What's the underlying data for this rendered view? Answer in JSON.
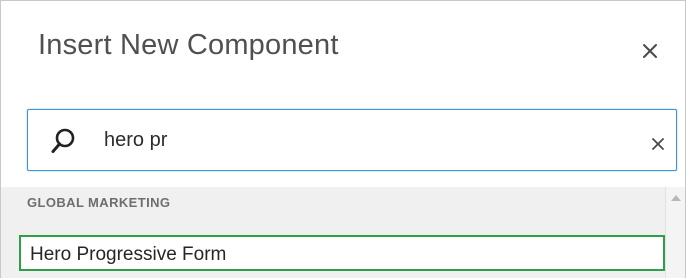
{
  "dialog": {
    "title": "Insert New Component",
    "close_icon": "close-icon"
  },
  "search": {
    "value": "hero pr",
    "search_icon": "search-icon",
    "clear_icon": "clear-icon",
    "focus_color": "#3a93d6"
  },
  "results": {
    "groups": [
      {
        "label": "GLOBAL MARKETING",
        "items": [
          {
            "label": "Hero Progressive Form",
            "selected": true
          }
        ]
      }
    ],
    "selection_color": "#2e9e4a"
  }
}
